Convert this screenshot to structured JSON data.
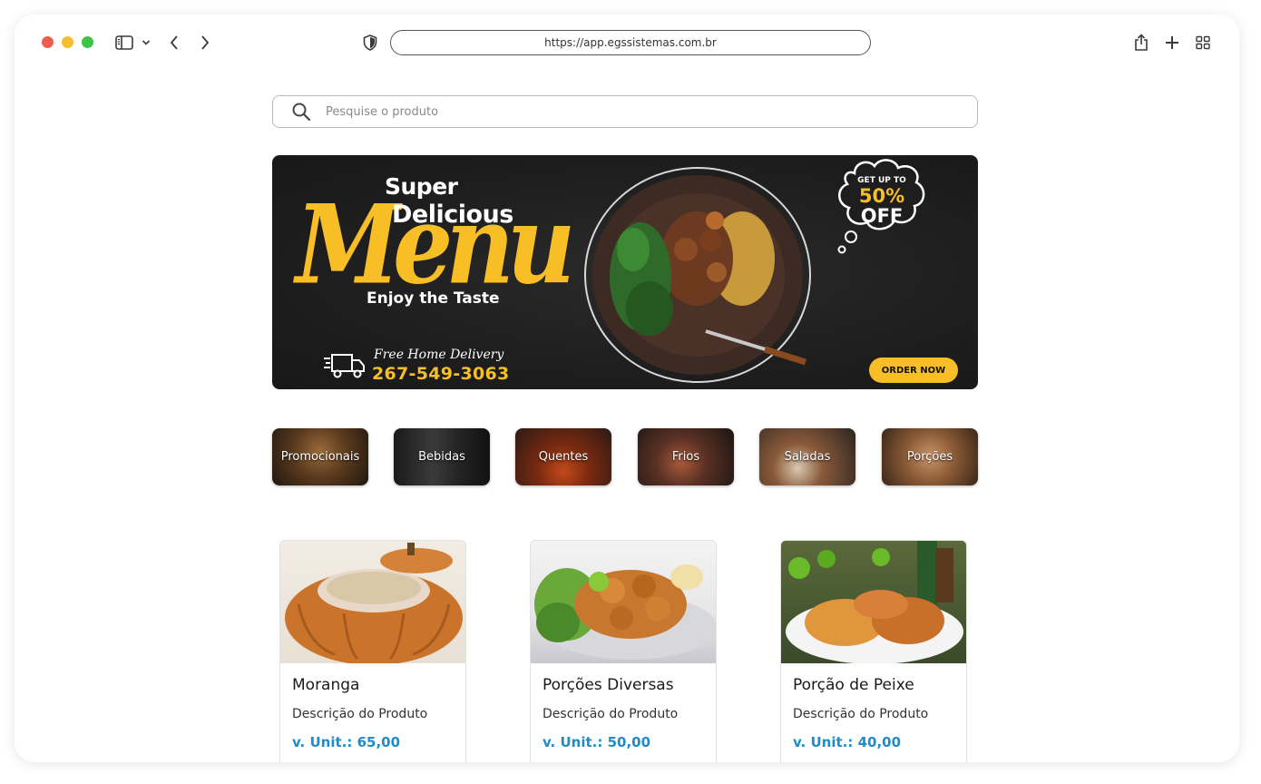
{
  "browser": {
    "url": "https://app.egssistemas.com.br",
    "icons": [
      "sidebar-icon",
      "chevron-down-icon",
      "back-icon",
      "forward-icon",
      "shield-icon",
      "share-icon",
      "new-tab-icon",
      "tab-overview-icon"
    ]
  },
  "search": {
    "placeholder": "Pesquise o produto",
    "value": ""
  },
  "banner": {
    "line1": "Super",
    "line2": "Delicious",
    "headline": "Menu",
    "tagline": "Enjoy the Taste",
    "delivery": "Free Home Delivery",
    "phone": "267-549-3063",
    "promo_top": "GET UP TO",
    "promo_value": "50%",
    "promo_off": "OFF",
    "cta": "ORDER NOW",
    "colors": {
      "accent": "#f8be25",
      "background": "#1e1e1e"
    }
  },
  "categories": [
    {
      "label": "Promocionais"
    },
    {
      "label": "Bebidas"
    },
    {
      "label": "Quentes"
    },
    {
      "label": "Frios"
    },
    {
      "label": "Saladas"
    },
    {
      "label": "Porções"
    }
  ],
  "products": [
    {
      "name": "Moranga",
      "description": "Descrição do Produto",
      "price": "v. Unit.: 65,00"
    },
    {
      "name": "Porções Diversas",
      "description": "Descrição do Produto",
      "price": "v. Unit.: 50,00"
    },
    {
      "name": "Porção de Peixe",
      "description": "Descrição do Produto",
      "price": "v. Unit.: 40,00"
    }
  ],
  "colors": {
    "price": "#1d8ccd",
    "window_red": "#ee5c4d",
    "window_yellow": "#f6be2f",
    "window_green": "#3cc348"
  }
}
